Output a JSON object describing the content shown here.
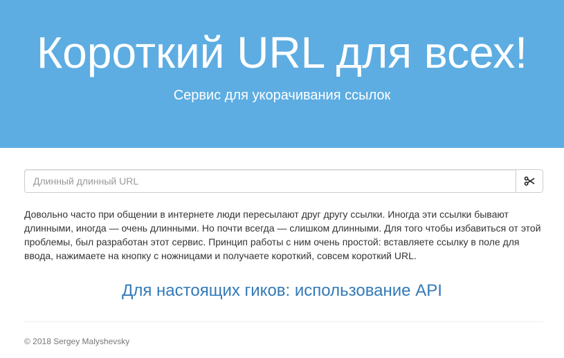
{
  "colors": {
    "hero_background": "#5dade2",
    "hero_text": "#ffffff",
    "link": "#337ab7",
    "body_text": "#333333",
    "footer_text": "#777777"
  },
  "hero": {
    "title": "Короткий URL для всех!",
    "subtitle": "Сервис для укорачивания ссылок"
  },
  "shortener": {
    "input_placeholder": "Длинный длинный URL",
    "input_value": "",
    "button_icon": "scissors-icon"
  },
  "description": "Довольно часто при общении в интернете люди пересылают друг другу ссылки. Иногда эти ссылки бывают длинными, иногда — очень длинными. Но почти всегда — слишком длинными. Для того чтобы избавиться от этой проблемы, был разработан этот сервис. Принцип работы с ним очень простой: вставляете ссылку в поле для ввода, нажимаете на кнопку с ножницами и получаете короткий, совсем короткий URL.",
  "api_link_text": "Для настоящих гиков: использование API",
  "footer": {
    "copyright": "© 2018 Sergey Malyshevsky"
  }
}
